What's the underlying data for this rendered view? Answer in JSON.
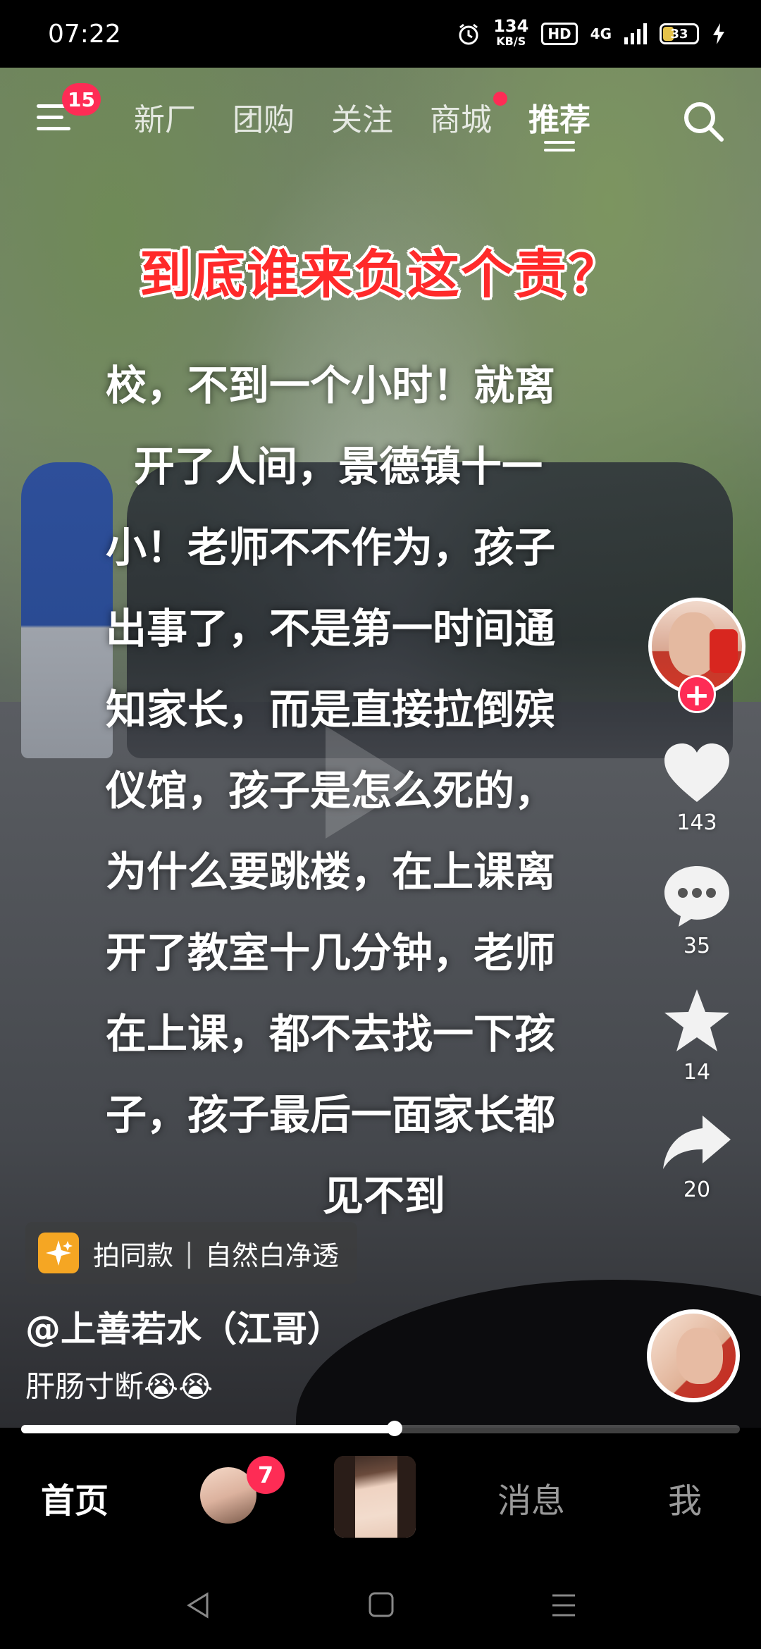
{
  "status_bar": {
    "time": "07:22",
    "net_speed_value": "134",
    "net_speed_unit": "KB/S",
    "hd_label": "HD",
    "network_label": "4G",
    "battery_level": "33"
  },
  "top_nav": {
    "menu_badge": "15",
    "tabs": [
      {
        "label": "新厂"
      },
      {
        "label": "团购"
      },
      {
        "label": "关注"
      },
      {
        "label": "商城"
      },
      {
        "label": "推荐"
      }
    ],
    "active_tab": "推荐"
  },
  "video": {
    "headline": "到底谁来负这个责？",
    "caption_lines": [
      "校，不到一个小时！就离",
      "开了人间，景德镇十一",
      "小！老师不不作为，孩子",
      "出事了，不是第一时间通",
      "知家长，而是直接拉倒殡",
      "仪馆，孩子是怎么死的，",
      "为什么要跳楼，在上课离",
      "开了教室十几分钟，老师",
      "在上课，都不去找一下孩",
      "子，孩子最后一面家长都",
      "见不到"
    ]
  },
  "actions": {
    "likes": "143",
    "comments": "35",
    "favorites": "14",
    "shares": "20"
  },
  "info": {
    "tag_label": "拍同款",
    "tag_divider": "|",
    "tag_effect": "自然白净透",
    "author": "@上善若水（江哥）",
    "description": "肝肠寸断😭😭"
  },
  "progress": {
    "fraction": 0.52
  },
  "bottom_tabs": {
    "home": "首页",
    "friends_badge": "7",
    "messages": "消息",
    "me": "我"
  },
  "colors": {
    "accent": "#fe2c55",
    "headline": "#ff2a2a"
  }
}
